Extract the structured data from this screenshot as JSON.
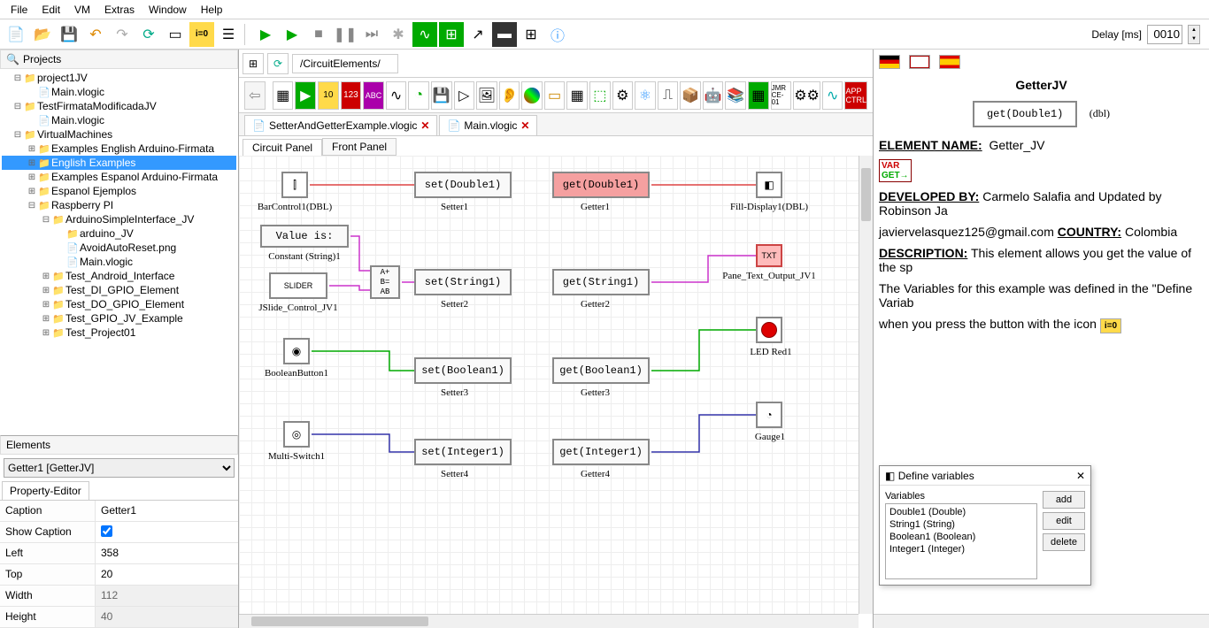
{
  "menu": [
    "File",
    "Edit",
    "VM",
    "Extras",
    "Window",
    "Help"
  ],
  "delay": {
    "label": "Delay [ms]",
    "value": "0010"
  },
  "projects_header": "Projects",
  "tree": [
    {
      "d": 0,
      "tw": "⊟",
      "ic": "📁",
      "lbl": "project1JV"
    },
    {
      "d": 1,
      "tw": "",
      "ic": "📄",
      "lbl": "Main.vlogic"
    },
    {
      "d": 0,
      "tw": "⊟",
      "ic": "📁",
      "lbl": "TestFirmataModificadaJV"
    },
    {
      "d": 1,
      "tw": "",
      "ic": "📄",
      "lbl": "Main.vlogic"
    },
    {
      "d": 0,
      "tw": "⊟",
      "ic": "📁",
      "lbl": "VirtualMachines"
    },
    {
      "d": 1,
      "tw": "⊞",
      "ic": "📁",
      "lbl": "Examples English Arduino-Firmata"
    },
    {
      "d": 1,
      "tw": "⊞",
      "ic": "📁",
      "lbl": "English Examples",
      "sel": true
    },
    {
      "d": 1,
      "tw": "⊞",
      "ic": "📁",
      "lbl": "Examples Espanol Arduino-Firmata"
    },
    {
      "d": 1,
      "tw": "⊞",
      "ic": "📁",
      "lbl": "Espanol Ejemplos"
    },
    {
      "d": 1,
      "tw": "⊟",
      "ic": "📁",
      "lbl": "Raspberry PI"
    },
    {
      "d": 2,
      "tw": "⊟",
      "ic": "📁",
      "lbl": "ArduinoSimpleInterface_JV"
    },
    {
      "d": 3,
      "tw": "",
      "ic": "📁",
      "lbl": "arduino_JV"
    },
    {
      "d": 3,
      "tw": "",
      "ic": "📄",
      "lbl": "AvoidAutoReset.png"
    },
    {
      "d": 3,
      "tw": "",
      "ic": "📄",
      "lbl": "Main.vlogic"
    },
    {
      "d": 2,
      "tw": "⊞",
      "ic": "📁",
      "lbl": "Test_Android_Interface"
    },
    {
      "d": 2,
      "tw": "⊞",
      "ic": "📁",
      "lbl": "Test_DI_GPIO_Element"
    },
    {
      "d": 2,
      "tw": "⊞",
      "ic": "📁",
      "lbl": "Test_DO_GPIO_Element"
    },
    {
      "d": 2,
      "tw": "⊞",
      "ic": "📁",
      "lbl": "Test_GPIO_JV_Example"
    },
    {
      "d": 2,
      "tw": "⊞",
      "ic": "📁",
      "lbl": "Test_Project01"
    }
  ],
  "elements_header": "Elements",
  "elements_selected": "Getter1 [GetterJV]",
  "property_tab": "Property-Editor",
  "props": [
    {
      "k": "Caption",
      "v": "Getter1",
      "ro": false
    },
    {
      "k": "Show Caption",
      "v": "☑",
      "ro": false,
      "chk": true
    },
    {
      "k": "Left",
      "v": "358",
      "ro": false
    },
    {
      "k": "Top",
      "v": "20",
      "ro": false
    },
    {
      "k": "Width",
      "v": "112",
      "ro": true
    },
    {
      "k": "Height",
      "v": "40",
      "ro": true
    }
  ],
  "path": "/CircuitElements/",
  "file_tabs": [
    {
      "lbl": "SetterAndGetterExample.vlogic"
    },
    {
      "lbl": "Main.vlogic"
    }
  ],
  "subtabs": [
    "Circuit Panel",
    "Front Panel"
  ],
  "canvas": {
    "barcontrol": "BarControl1(DBL)",
    "set_double": "set(Double1)",
    "setter1": "Setter1",
    "get_double": "get(Double1)",
    "getter1": "Getter1",
    "fill_display": "Fill-Display1(DBL)",
    "value_is": "Value is:",
    "constant": "Constant (String)1",
    "ab": "A+\nB=\nAB",
    "set_string": "set(String1)",
    "setter2": "Setter2",
    "get_string": "get(String1)",
    "getter2": "Getter2",
    "pane_text": "Pane_Text_Output_JV1",
    "slider": "SLIDER",
    "jslide": "JSlide_Control_JV1",
    "boolbtn": "BooleanButton1",
    "set_bool": "set(Boolean1)",
    "setter3": "Setter3",
    "get_bool": "get(Boolean1)",
    "getter3": "Getter3",
    "led": "LED Red1",
    "multiswitch": "Multi-Switch1",
    "set_int": "set(Integer1)",
    "setter4": "Setter4",
    "get_int": "get(Integer1)",
    "getter4": "Getter4",
    "gauge": "Gauge1"
  },
  "doc": {
    "title": "GetterJV",
    "box": "get(Double1)",
    "dbl": "(dbl)",
    "element_name_k": "ELEMENT NAME:",
    "element_name_v": "Getter_JV",
    "dev_k": "DEVELOPED BY:",
    "dev_v": "Carmelo Salafia and Updated by Robinson Ja",
    "email": "javiervelasquez125@gmail.com",
    "country_k": "COUNTRY:",
    "country_v": "Colombia",
    "desc_k": "DESCRIPTION:",
    "desc_v": "This element allows you get the value of the sp",
    "vars_line": "The Variables for this example was defined in the \"Define Variab",
    "icon_line": "when you press the button with the icon"
  },
  "var_dialog": {
    "title": "Define variables",
    "list_hdr": "Variables",
    "items": [
      "Double1 (Double)",
      "String1 (String)",
      "Boolean1 (Boolean)",
      "Integer1 (Integer)"
    ],
    "btns": [
      "add",
      "edit",
      "delete"
    ]
  }
}
